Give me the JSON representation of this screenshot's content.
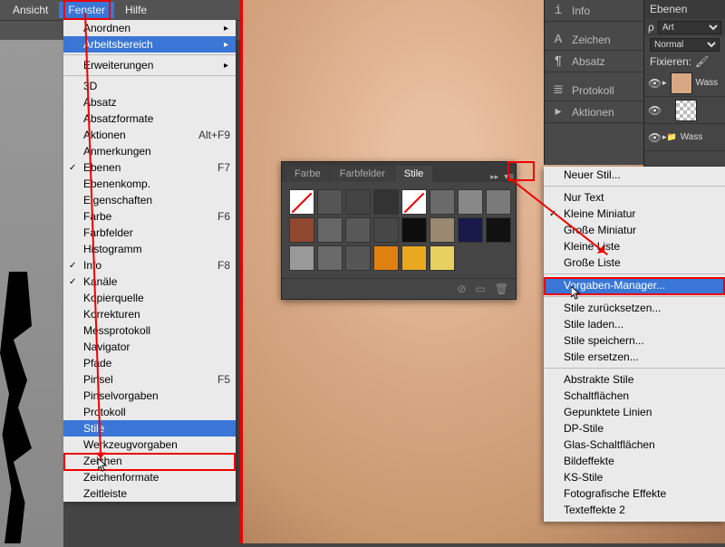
{
  "menubar": {
    "items": [
      "Ansicht",
      "Fenster",
      "Hilfe"
    ],
    "open_index": 1
  },
  "fenster_menu": {
    "groups": [
      [
        {
          "label": "Anordnen",
          "sub": true
        },
        {
          "label": "Arbeitsbereich",
          "sub": true,
          "selected": true
        }
      ],
      [
        {
          "label": "Erweiterungen",
          "sub": true
        }
      ],
      [
        {
          "label": "3D"
        },
        {
          "label": "Absatz"
        },
        {
          "label": "Absatzformate"
        },
        {
          "label": "Aktionen",
          "shortcut": "Alt+F9"
        },
        {
          "label": "Anmerkungen"
        },
        {
          "label": "Ebenen",
          "shortcut": "F7",
          "checked": true
        },
        {
          "label": "Ebenenkomp."
        },
        {
          "label": "Eigenschaften"
        },
        {
          "label": "Farbe",
          "shortcut": "F6"
        },
        {
          "label": "Farbfelder"
        },
        {
          "label": "Histogramm"
        },
        {
          "label": "Info",
          "shortcut": "F8",
          "checked": true
        },
        {
          "label": "Kanäle",
          "checked": true
        },
        {
          "label": "Kopierquelle"
        },
        {
          "label": "Korrekturen"
        },
        {
          "label": "Messprotokoll"
        },
        {
          "label": "Navigator"
        },
        {
          "label": "Pfade"
        },
        {
          "label": "Pinsel",
          "shortcut": "F5"
        },
        {
          "label": "Pinselvorgaben"
        },
        {
          "label": "Protokoll"
        },
        {
          "label": "Stile",
          "selected": true
        },
        {
          "label": "Werkzeugvorgaben"
        },
        {
          "label": "Zeichen"
        },
        {
          "label": "Zeichenformate"
        },
        {
          "label": "Zeitleiste"
        }
      ]
    ]
  },
  "styles_panel": {
    "tabs": [
      "Farbe",
      "Farbfelder",
      "Stile"
    ],
    "active_tab": 2,
    "expand_icon": "▸▸",
    "flyout_icon": "▾≡",
    "swatches": [
      {
        "type": "nostyle"
      },
      {
        "bg": "#555"
      },
      {
        "bg": "#444"
      },
      {
        "bg": "#333"
      },
      {
        "type": "nostyle"
      },
      {
        "bg": "#6a6a6a"
      },
      {
        "bg": "#888"
      },
      {
        "bg": "#7a7a7a"
      },
      {
        "bg": "#904830"
      },
      {
        "bg": "#666"
      },
      {
        "bg": "#585858"
      },
      {
        "bg": "#474747"
      },
      {
        "bg": "#0d0d0d"
      },
      {
        "bg": "#9a8870"
      },
      {
        "bg": "#1a1a4a"
      },
      {
        "bg": "#111"
      },
      {
        "bg": "#999"
      },
      {
        "bg": "#6a6a6a"
      },
      {
        "bg": "#555"
      },
      {
        "bg": "#e08010"
      },
      {
        "bg": "#e8a820"
      },
      {
        "bg": "#e8d060"
      }
    ],
    "footer_icons": [
      "⊘",
      "▭",
      "🗑"
    ]
  },
  "right_panels": {
    "items": [
      {
        "icon": "i",
        "label": "Info"
      },
      {
        "icon": "A",
        "label": "Zeichen"
      },
      {
        "icon": "¶",
        "label": "Absatz"
      },
      {
        "icon": "≣",
        "label": "Protokoll"
      },
      {
        "icon": "▸",
        "label": "Aktionen"
      }
    ]
  },
  "layers": {
    "tab": "Ebenen",
    "kind_label": "ρ",
    "kind_value": "Art",
    "blend": "Normal",
    "lock_label": "Fixieren:",
    "rows": [
      {
        "name": "Wass",
        "thumb": "skin",
        "eye": true,
        "arrow": true
      },
      {
        "name": "",
        "thumb": "checker",
        "eye": true
      },
      {
        "name": "Wass",
        "thumb": "skin",
        "eye": true,
        "folder": true
      }
    ]
  },
  "context_menu": {
    "groups": [
      [
        {
          "label": "Neuer Stil..."
        }
      ],
      [
        {
          "label": "Nur Text"
        },
        {
          "label": "Kleine Miniatur",
          "checked": true
        },
        {
          "label": "Große Miniatur"
        },
        {
          "label": "Kleine Liste"
        },
        {
          "label": "Große Liste"
        }
      ],
      [
        {
          "label": "Vorgaben-Manager...",
          "selected": true
        }
      ],
      [
        {
          "label": "Stile zurücksetzen..."
        },
        {
          "label": "Stile laden..."
        },
        {
          "label": "Stile speichern..."
        },
        {
          "label": "Stile ersetzen..."
        }
      ],
      [
        {
          "label": "Abstrakte Stile"
        },
        {
          "label": "Schaltflächen"
        },
        {
          "label": "Gepunktete Linien"
        },
        {
          "label": "DP-Stile"
        },
        {
          "label": "Glas-Schaltflächen"
        },
        {
          "label": "Bildeffekte"
        },
        {
          "label": "KS-Stile"
        },
        {
          "label": "Fotografische Effekte"
        },
        {
          "label": "Texteffekte 2"
        }
      ]
    ]
  }
}
